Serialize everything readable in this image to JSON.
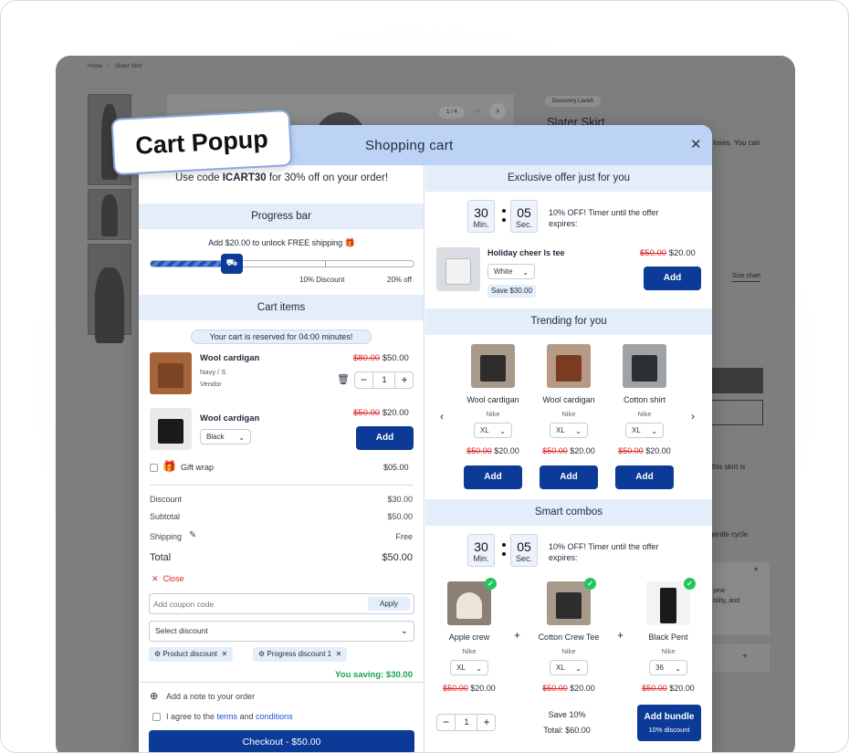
{
  "badge": "Cart Popup",
  "page": {
    "breadcrumb": [
      "Home",
      "›",
      "Slater Skirt"
    ],
    "pager": "1 / 4",
    "brand": "Discovery Lavish",
    "title": "Slater Skirt",
    "snippet": "loses. You can",
    "size_chart": "Size chart",
    "text2": "this skirt is",
    "text3": "gentle cycle",
    "text4": "year",
    "text5": "bility, and"
  },
  "popup": {
    "title": "Shopping cart",
    "promo": {
      "prefix": "Use code ",
      "code": "ICART30",
      "suffix": " for 30% off on your order!"
    },
    "progress": {
      "heading": "Progress bar",
      "message": "Add $20.00 to unlock FREE shipping 🎁",
      "fill": 0.31,
      "marker1": "10% Discount",
      "marker2": "20% off"
    },
    "cart": {
      "heading": "Cart items",
      "reserved": "Your cart is reserved for 04:00 minutes!",
      "items": [
        {
          "name": "Wool cardigan",
          "variant": "Navy / S",
          "vendor": "Vendor",
          "old": "$80.00",
          "price": "$50.00",
          "qty": "1"
        },
        {
          "name": "Wool cardigan",
          "select": "Black",
          "old": "$50.00",
          "price": "$20.00",
          "add": "Add"
        }
      ],
      "gift": {
        "label": "Gift wrap",
        "price": "$05.00"
      }
    },
    "summary": {
      "discount_label": "Discount",
      "discount": "$30.00",
      "subtotal_label": "Subtotal",
      "subtotal": "$50.00",
      "shipping_label": "Shipping",
      "shipping": "Free",
      "total_label": "Total",
      "total": "$50.00",
      "close": "Close"
    },
    "coupon": {
      "placeholder": "Add coupon code",
      "apply": "Apply",
      "select": "Select discount",
      "tags": [
        "Product discount",
        "Progress discount 1"
      ],
      "saving": "You saving: $30.00"
    },
    "note": "Add a note to your order",
    "terms": {
      "prefix": "I agree to the ",
      "terms": "terms",
      "and": " and ",
      "conditions": "conditions"
    },
    "checkout": "Checkout - $50.00",
    "exclusive": {
      "heading": "Exclusive offer just for you",
      "timer": {
        "min": "30",
        "min_label": "Min.",
        "sec": "05",
        "sec_label": "Sec."
      },
      "timer_text": "10% OFF! Timer until the offer expires:",
      "name": "Holiday cheer ls tee",
      "select": "White",
      "save": "Save $30.00",
      "old": "$50.00",
      "price": "$20.00",
      "add": "Add"
    },
    "trending": {
      "heading": "Trending for you",
      "items": [
        {
          "name": "Wool cardigan",
          "brand": "Nike",
          "size": "XL",
          "old": "$50.00",
          "price": "$20.00",
          "add": "Add"
        },
        {
          "name": "Wool cardigan",
          "brand": "Nike",
          "size": "XL",
          "old": "$50.00",
          "price": "$20.00",
          "add": "Add"
        },
        {
          "name": "Cotton shirt",
          "brand": "Nike",
          "size": "XL",
          "old": "$50.00",
          "price": "$20.00",
          "add": "Add"
        }
      ]
    },
    "combos": {
      "heading": "Smart combos",
      "timer": {
        "min": "30",
        "min_label": "Min.",
        "sec": "05",
        "sec_label": "Sec."
      },
      "timer_text": "10% OFF! Timer until the offer expires:",
      "items": [
        {
          "name": "Apple crew",
          "brand": "Nike",
          "size": "XL",
          "old": "$50.00",
          "price": "$20.00"
        },
        {
          "name": "Cotton Crew Tee",
          "brand": "Nike",
          "size": "XL",
          "old": "$50.00",
          "price": "$20.00"
        },
        {
          "name": "Black Pent",
          "brand": "Nike",
          "size": "36",
          "old": "$50.00",
          "price": "$20.00"
        }
      ],
      "qty": "1",
      "save": "Save 10%",
      "total": "Total: $60.00",
      "bundle": "Add bundle",
      "bundle_sub": "10% discount"
    }
  },
  "colors": {
    "accent": "#0b3b97",
    "band": "#e4eefb",
    "header": "#bcd3f6",
    "sale": "#dc2626",
    "saving": "#16a34a"
  }
}
